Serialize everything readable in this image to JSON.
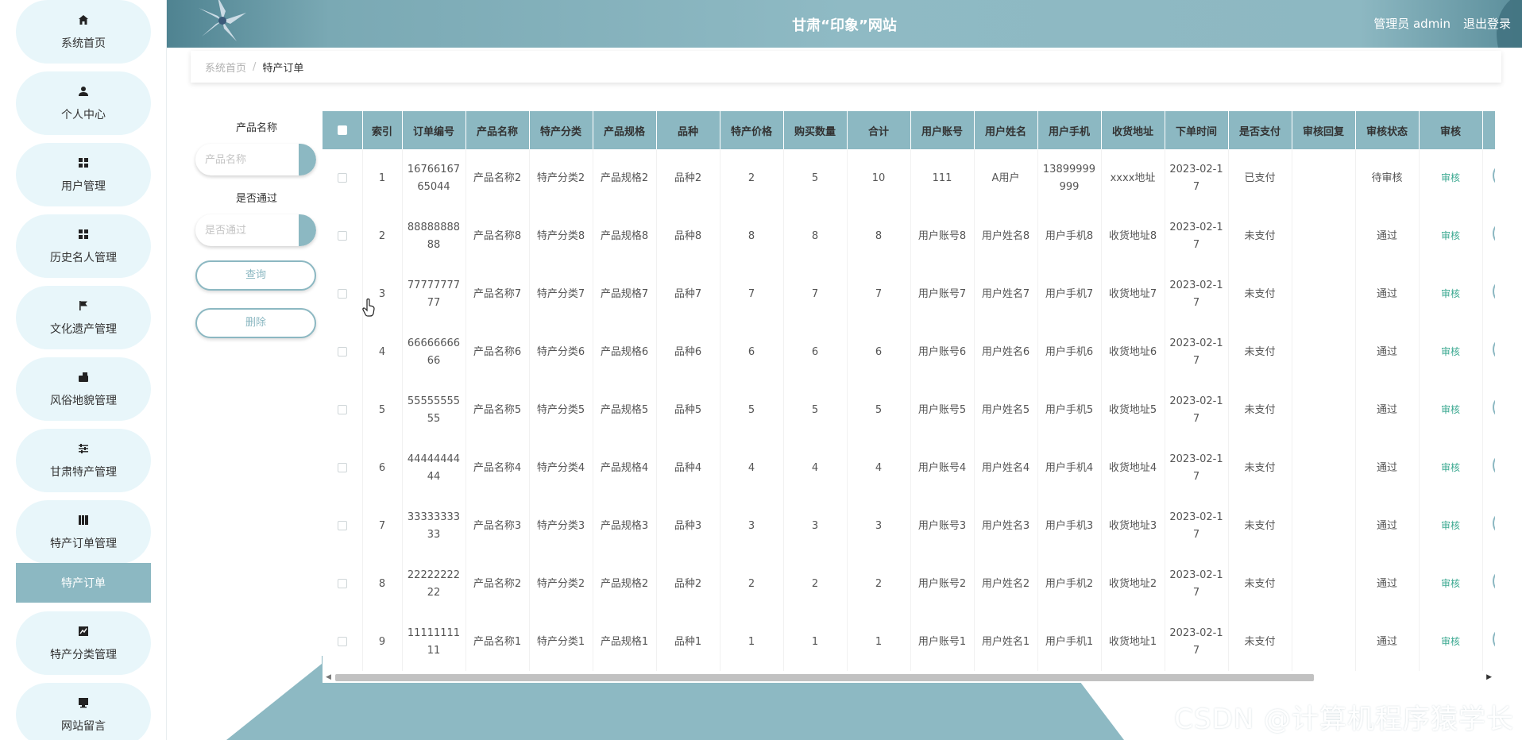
{
  "header": {
    "title": "甘肃“印象”网站",
    "user": "管理员 admin",
    "logout": "退出登录"
  },
  "sidebar": {
    "items": [
      {
        "label": "系统首页",
        "icon": "home-icon"
      },
      {
        "label": "个人中心",
        "icon": "user-icon"
      },
      {
        "label": "用户管理",
        "icon": "grid-icon"
      },
      {
        "label": "历史名人管理",
        "icon": "grid-icon"
      },
      {
        "label": "文化遗产管理",
        "icon": "flag-icon"
      },
      {
        "label": "风俗地貌管理",
        "icon": "wallet-icon"
      },
      {
        "label": "甘肃特产管理",
        "icon": "sliders-icon"
      },
      {
        "label": "特产订单管理",
        "icon": "book-icon"
      },
      {
        "label": "特产订单",
        "icon": ""
      },
      {
        "label": "特产分类管理",
        "icon": "chart-icon"
      },
      {
        "label": "网站留言",
        "icon": "monitor-icon"
      }
    ]
  },
  "breadcrumb": {
    "home": "系统首页",
    "sep": "/",
    "current": "特产订单"
  },
  "search": {
    "product_label": "产品名称",
    "product_placeholder": "产品名称",
    "pass_label": "是否通过",
    "pass_placeholder": "是否通过",
    "query_button": "查询",
    "delete_button": "删除"
  },
  "table": {
    "headers": [
      "索引",
      "订单编号",
      "产品名称",
      "特产分类",
      "产品规格",
      "品种",
      "特产价格",
      "购买数量",
      "合计",
      "用户账号",
      "用户姓名",
      "用户手机",
      "收货地址",
      "下单时间",
      "是否支付",
      "审核回复",
      "审核状态",
      "审核"
    ],
    "rows": [
      {
        "index": "1",
        "order_no": "1676616765044",
        "name": "产品名称2",
        "category": "特产分类2",
        "spec": "产品规格2",
        "variety": "品种2",
        "price": "2",
        "qty": "5",
        "total": "10",
        "account": "111",
        "username": "A用户",
        "phone": "13899999999",
        "address": "xxxx地址",
        "time": "2023-02-17",
        "paid": "已支付",
        "reply": "",
        "status": "待审核",
        "audit": "审核"
      },
      {
        "index": "2",
        "order_no": "8888888888",
        "name": "产品名称8",
        "category": "特产分类8",
        "spec": "产品规格8",
        "variety": "品种8",
        "price": "8",
        "qty": "8",
        "total": "8",
        "account": "用户账号8",
        "username": "用户姓名8",
        "phone": "用户手机8",
        "address": "收货地址8",
        "time": "2023-02-17",
        "paid": "未支付",
        "reply": "",
        "status": "通过",
        "audit": "审核"
      },
      {
        "index": "3",
        "order_no": "7777777777",
        "name": "产品名称7",
        "category": "特产分类7",
        "spec": "产品规格7",
        "variety": "品种7",
        "price": "7",
        "qty": "7",
        "total": "7",
        "account": "用户账号7",
        "username": "用户姓名7",
        "phone": "用户手机7",
        "address": "收货地址7",
        "time": "2023-02-17",
        "paid": "未支付",
        "reply": "",
        "status": "通过",
        "audit": "审核"
      },
      {
        "index": "4",
        "order_no": "6666666666",
        "name": "产品名称6",
        "category": "特产分类6",
        "spec": "产品规格6",
        "variety": "品种6",
        "price": "6",
        "qty": "6",
        "total": "6",
        "account": "用户账号6",
        "username": "用户姓名6",
        "phone": "用户手机6",
        "address": "收货地址6",
        "time": "2023-02-17",
        "paid": "未支付",
        "reply": "",
        "status": "通过",
        "audit": "审核"
      },
      {
        "index": "5",
        "order_no": "5555555555",
        "name": "产品名称5",
        "category": "特产分类5",
        "spec": "产品规格5",
        "variety": "品种5",
        "price": "5",
        "qty": "5",
        "total": "5",
        "account": "用户账号5",
        "username": "用户姓名5",
        "phone": "用户手机5",
        "address": "收货地址5",
        "time": "2023-02-17",
        "paid": "未支付",
        "reply": "",
        "status": "通过",
        "audit": "审核"
      },
      {
        "index": "6",
        "order_no": "4444444444",
        "name": "产品名称4",
        "category": "特产分类4",
        "spec": "产品规格4",
        "variety": "品种4",
        "price": "4",
        "qty": "4",
        "total": "4",
        "account": "用户账号4",
        "username": "用户姓名4",
        "phone": "用户手机4",
        "address": "收货地址4",
        "time": "2023-02-17",
        "paid": "未支付",
        "reply": "",
        "status": "通过",
        "audit": "审核"
      },
      {
        "index": "7",
        "order_no": "3333333333",
        "name": "产品名称3",
        "category": "特产分类3",
        "spec": "产品规格3",
        "variety": "品种3",
        "price": "3",
        "qty": "3",
        "total": "3",
        "account": "用户账号3",
        "username": "用户姓名3",
        "phone": "用户手机3",
        "address": "收货地址3",
        "time": "2023-02-17",
        "paid": "未支付",
        "reply": "",
        "status": "通过",
        "audit": "审核"
      },
      {
        "index": "8",
        "order_no": "2222222222",
        "name": "产品名称2",
        "category": "特产分类2",
        "spec": "产品规格2",
        "variety": "品种2",
        "price": "2",
        "qty": "2",
        "total": "2",
        "account": "用户账号2",
        "username": "用户姓名2",
        "phone": "用户手机2",
        "address": "收货地址2",
        "time": "2023-02-17",
        "paid": "未支付",
        "reply": "",
        "status": "通过",
        "audit": "审核"
      },
      {
        "index": "9",
        "order_no": "1111111111",
        "name": "产品名称1",
        "category": "特产分类1",
        "spec": "产品规格1",
        "variety": "品种1",
        "price": "1",
        "qty": "1",
        "total": "1",
        "account": "用户账号1",
        "username": "用户姓名1",
        "phone": "用户手机1",
        "address": "收货地址1",
        "time": "2023-02-17",
        "paid": "未支付",
        "reply": "",
        "status": "通过",
        "audit": "审核"
      }
    ]
  },
  "watermark": "CSDN @计算机程序猿学长",
  "colors": {
    "accent": "#8cb8c2",
    "nav_bg": "#e8f6fa",
    "audit_link": "#3aa890"
  }
}
